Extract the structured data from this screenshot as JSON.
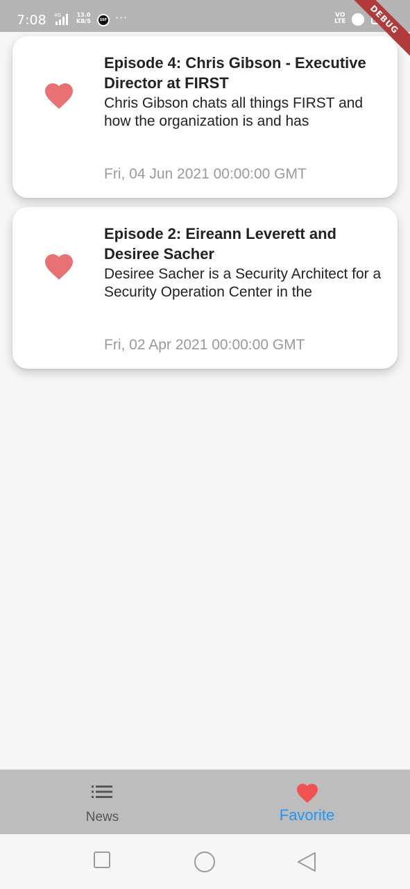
{
  "status_bar": {
    "time": "7:08",
    "network": "4G",
    "speed_value": "13.0",
    "speed_unit": "KB/S",
    "app_icon_text": "SSF",
    "more": "···",
    "volte_top": "VO",
    "volte_bottom": "LTE"
  },
  "debug_banner": "DEBUG",
  "episodes": [
    {
      "title": "Episode 4: Chris Gibson - Executive Director at FIRST",
      "description": "Chris Gibson chats all things FIRST and how the organization is and has",
      "date": "Fri, 04 Jun 2021 00:00:00 GMT",
      "favorited": true
    },
    {
      "title": "Episode 2: Eireann Leverett and Desiree Sacher",
      "description": "Desiree Sacher is a Security Architect for a Security Operation Center in the",
      "date": "Fri, 02 Apr 2021 00:00:00 GMT",
      "favorited": true
    }
  ],
  "bottom_nav": {
    "items": [
      {
        "label": "News",
        "icon": "list-icon",
        "active": false
      },
      {
        "label": "Favorite",
        "icon": "heart-icon",
        "active": true
      }
    ]
  },
  "colors": {
    "heart": "#e87273",
    "active_tab": "#2196f3",
    "active_heart": "#ef5350",
    "nav_background": "#bdbdbd",
    "status_bar": "#b4b4b4",
    "date_text": "#9a9a9a"
  },
  "system_nav": {
    "buttons": [
      "recent-apps-icon",
      "home-icon",
      "back-icon"
    ]
  }
}
